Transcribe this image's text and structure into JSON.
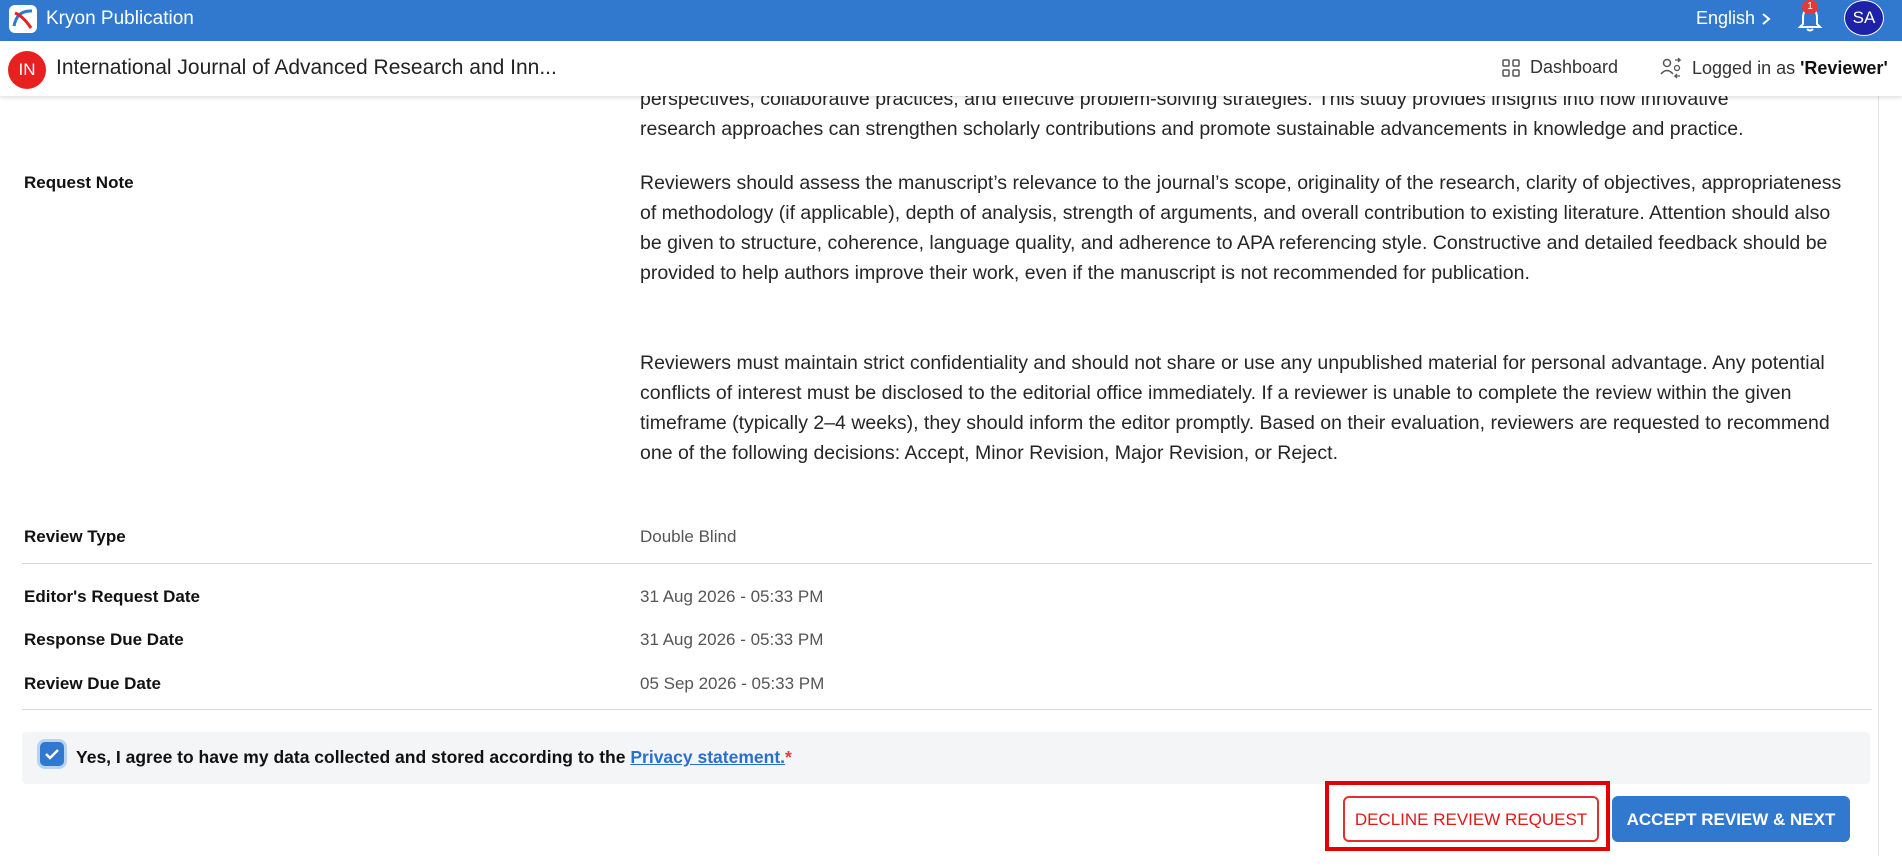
{
  "topbar": {
    "brand": "Kryon Publication",
    "language": "English",
    "notification_count": "1",
    "user_initials": "SA"
  },
  "subheader": {
    "journal_initials": "IN",
    "journal_title": "International Journal of Advanced Research and Inn...",
    "dashboard_label": "Dashboard",
    "logged_in_prefix": "Logged in as",
    "logged_in_role": "'Reviewer'"
  },
  "abstract": {
    "line1": "perspectives, collaborative practices, and effective problem-solving strategies. This study provides insights into how innovative",
    "line2": "research approaches can strengthen scholarly contributions and promote sustainable advancements in knowledge and practice."
  },
  "request_note": {
    "label": "Request Note",
    "paragraph1": "Reviewers should assess the manuscript’s relevance to the journal’s scope, originality of the research, clarity of objectives, appropriateness of methodology (if applicable), depth of analysis, strength of arguments, and overall contribution to existing literature. Attention should also be given to structure, coherence, language quality, and adherence to APA referencing style. Constructive and detailed feedback should be provided to help authors improve their work, even if the manuscript is not recommended for publication.",
    "paragraph2": "Reviewers must maintain strict confidentiality and should not share or use any unpublished material for personal advantage. Any potential conflicts of interest must be disclosed to the editorial office immediately. If a reviewer is unable to complete the review within the given timeframe (typically 2–4 weeks), they should inform the editor promptly. Based on their evaluation, reviewers are requested to recommend one of the following decisions: Accept, Minor Revision, Major Revision, or Reject."
  },
  "details": {
    "review_type_label": "Review Type",
    "review_type_value": "Double Blind",
    "editor_request_label": "Editor's Request Date",
    "editor_request_value": "31 Aug 2026 - 05:33 PM",
    "response_due_label": "Response Due Date",
    "response_due_value": "31 Aug 2026 - 05:33 PM",
    "review_due_label": "Review Due Date",
    "review_due_value": "05 Sep 2026 - 05:33 PM"
  },
  "consent": {
    "checked": true,
    "text": "Yes, I agree to have my data collected and stored according to the",
    "link": "Privacy statement.",
    "required_mark": "*"
  },
  "actions": {
    "decline_label": "DECLINE REVIEW REQUEST",
    "accept_label": "ACCEPT REVIEW & NEXT"
  },
  "colors": {
    "primary": "#3178cf",
    "danger": "#e01818",
    "journal_badge": "#e8201f",
    "avatar": "#1e22a8"
  }
}
